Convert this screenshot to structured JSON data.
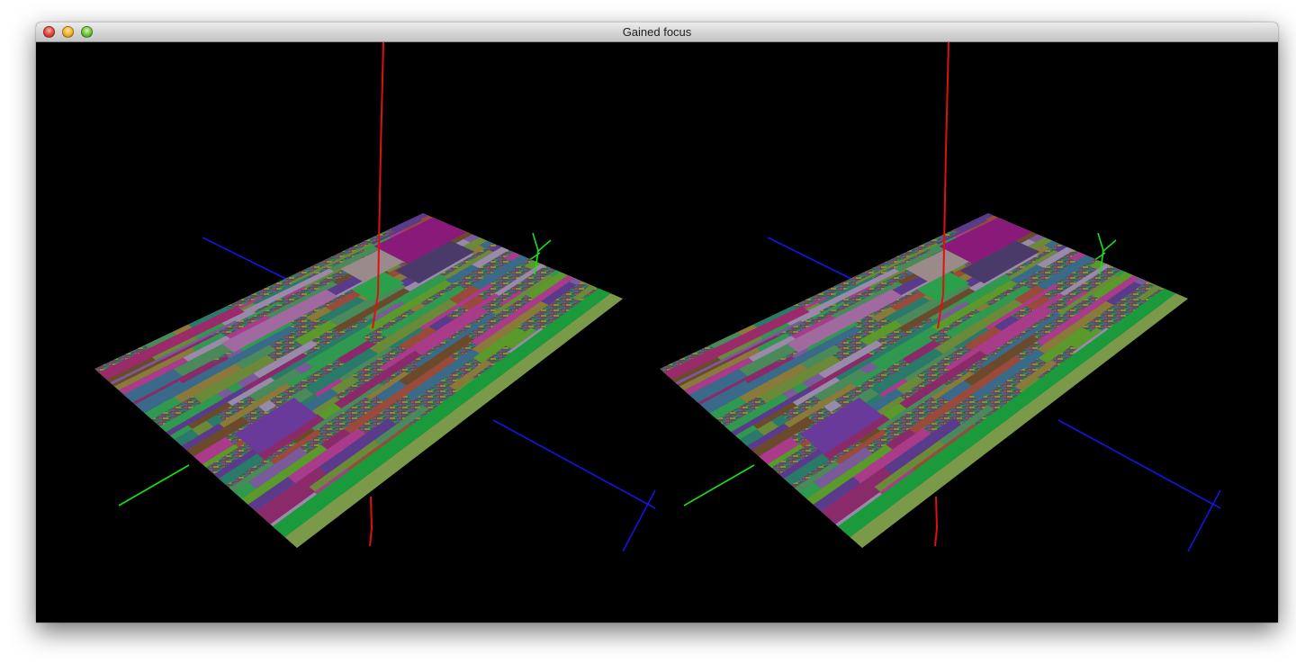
{
  "window": {
    "title": "Gained focus"
  },
  "scene": {
    "views": [
      "left-eye",
      "right-eye"
    ],
    "axis_colors": {
      "vertical": "#e01010",
      "x_axis": "#1414e6",
      "y_axis": "#16e016"
    },
    "axis_labels": [
      "Y",
      "X"
    ],
    "background": "#000000"
  },
  "colors": {
    "close": "#e0443a",
    "minimize": "#f2b22a",
    "zoom": "#6cc23a"
  }
}
